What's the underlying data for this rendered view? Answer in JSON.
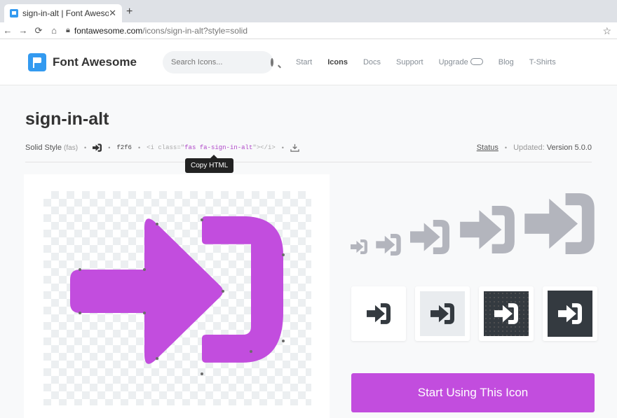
{
  "browser": {
    "tab_title": "sign-in-alt | Font Awesome",
    "new_tab_label": "+",
    "url_host": "fontawesome.com",
    "url_path": "/icons/sign-in-alt?style=solid"
  },
  "header": {
    "brand": "Font Awesome",
    "search_placeholder": "Search Icons...",
    "nav": [
      {
        "label": "Start"
      },
      {
        "label": "Icons"
      },
      {
        "label": "Docs"
      },
      {
        "label": "Support"
      },
      {
        "label": "Upgrade"
      },
      {
        "label": "Blog"
      },
      {
        "label": "T-Shirts"
      }
    ]
  },
  "icon_page": {
    "title": "sign-in-alt",
    "style_label": "Solid Style",
    "style_prefix": "(fas)",
    "unicode": "f2f6",
    "html_open": "<i class=\"",
    "html_classes": "fas fa-sign-in-alt",
    "html_close": "\"></i>",
    "tooltip": "Copy HTML",
    "status_link": "Status",
    "updated_label": "Updated:",
    "updated_version": "Version 5.0.0",
    "cta": "Start Using This Icon"
  },
  "colors": {
    "accent": "#c24dde",
    "brand_blue": "#339af0",
    "preview_gray": "#b3b5bd",
    "dark": "#343a40"
  },
  "icons": {
    "main": "sign-in-alt-icon",
    "copy_glyph": "sign-in-alt-icon",
    "download": "download-icon",
    "gamepad": "gamepad-icon",
    "search": "search-icon"
  }
}
